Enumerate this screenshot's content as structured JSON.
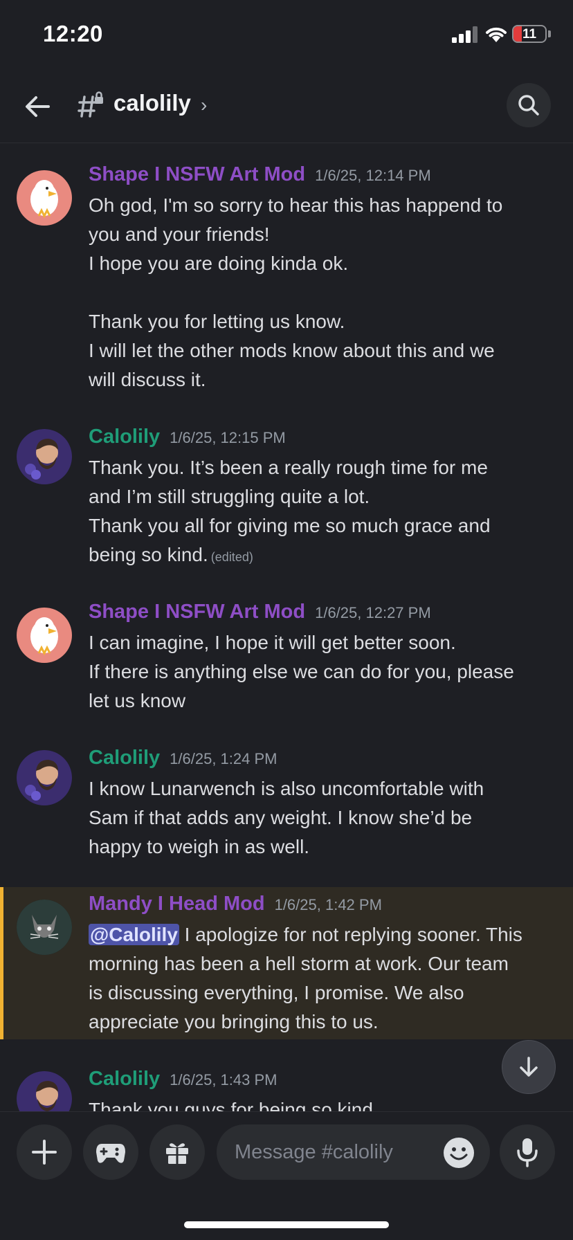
{
  "status_bar": {
    "time": "12:20",
    "battery": "11",
    "battery_level": 0.11
  },
  "header": {
    "channel": "calolily",
    "chevron": "›"
  },
  "colors": {
    "mod_purple": "#8e4ec6",
    "calolily_teal": "#1f9d78",
    "head_mod_purple": "#8e4ec6",
    "mention_bg": "#4e54a8",
    "highlight_border": "#f0b232"
  },
  "messages": [
    {
      "author": "Shape I NSFW Art Mod",
      "time": "1/6/25, 12:14 PM",
      "lines": [
        "Oh god, I'm so sorry to hear this has happend to",
        "you and your friends!",
        "I hope you are doing kinda ok.",
        "",
        "Thank you for letting us know.",
        "I will let the other mods know about this and we",
        "will discuss it."
      ]
    },
    {
      "author": "Calolily",
      "time": "1/6/25, 12:15 PM",
      "lines": [
        "Thank you. It’s been a really rough time for me",
        "and I’m still struggling quite a lot.",
        "Thank you all for giving me so much grace and",
        "being so kind."
      ],
      "edited": "(edited)"
    },
    {
      "author": "Shape I NSFW Art Mod",
      "time": "1/6/25, 12:27 PM",
      "lines": [
        "I can imagine, I hope it will get better soon.",
        "If there is anything else we can do for you, please",
        "let us know"
      ]
    },
    {
      "author": "Calolily",
      "time": "1/6/25, 1:24 PM",
      "lines": [
        "I know Lunarwench is also uncomfortable with",
        "Sam if that adds any weight. I know she’d be",
        "happy to weigh in as well."
      ]
    },
    {
      "author": "Mandy I Head Mod",
      "time": "1/6/25, 1:42 PM",
      "mention": "@Calolily",
      "first_line_rest": " I apologize for not replying sooner. This",
      "lines": [
        "morning has been a hell storm at work. Our team",
        "is discussing everything, I promise. We also",
        "appreciate you bringing this to us."
      ]
    },
    {
      "author": "Calolily",
      "time": "1/6/25, 1:43 PM",
      "lines": [
        "Thank you guys for being so kind"
      ]
    }
  ],
  "composer": {
    "placeholder": "Message #calolily"
  }
}
